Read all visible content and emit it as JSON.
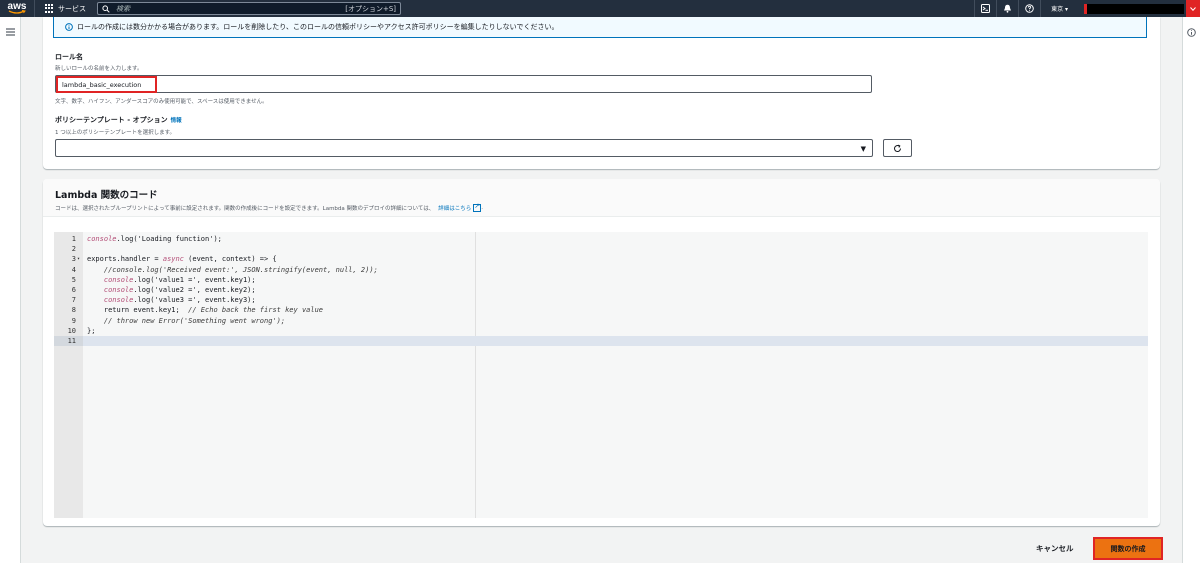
{
  "nav": {
    "logo": "aws",
    "services_label": "サービス",
    "search_placeholder": "検索",
    "search_shortcut": "[オプション+S]",
    "region": "東京 ▾"
  },
  "info_alert": {
    "text": "ロールの作成には数分かかる場合があります。ロールを削除したり、このロールの信頼ポリシーやアクセス許可ポリシーを編集したりしないでください。"
  },
  "role_name": {
    "label": "ロール名",
    "description": "新しいロールの名前を入力します。",
    "value": "lambda_basic_execution",
    "constraint": "文字、数字、ハイフン、アンダースコアのみ使用可能で、スペースは使用できません。"
  },
  "policy_templates": {
    "label": "ポリシーテンプレート - オプション",
    "info_link": "情報",
    "description": "1 つ以上のポリシーテンプレートを選択します。",
    "selected": ""
  },
  "code_section": {
    "title": "Lambda 関数のコード",
    "description": "コードは、選択されたブループリントによって事前に設定されます。関数の作成後にコードを設定できます。Lambda 関数のデプロイの詳細については、",
    "link": "詳細はこちら"
  },
  "code_lines": [
    {
      "n": "1",
      "fold": "",
      "segments": [
        [
          "fn",
          "console"
        ],
        [
          "",
          ".log('Loading function');"
        ]
      ]
    },
    {
      "n": "2",
      "fold": "",
      "segments": []
    },
    {
      "n": "3",
      "fold": "▾",
      "segments": [
        [
          "",
          "exports.handler = "
        ],
        [
          "fn",
          "async"
        ],
        [
          "",
          " (event, context) => {"
        ]
      ]
    },
    {
      "n": "4",
      "fold": "",
      "segments": [
        [
          "cm",
          "    //console.log('Received event:', JSON.stringify(event, null, 2));"
        ]
      ]
    },
    {
      "n": "5",
      "fold": "",
      "segments": [
        [
          "",
          "    "
        ],
        [
          "fn",
          "console"
        ],
        [
          "",
          ".log('value1 =', event.key1);"
        ]
      ]
    },
    {
      "n": "6",
      "fold": "",
      "segments": [
        [
          "",
          "    "
        ],
        [
          "fn",
          "console"
        ],
        [
          "",
          ".log('value2 =', event.key2);"
        ]
      ]
    },
    {
      "n": "7",
      "fold": "",
      "segments": [
        [
          "",
          "    "
        ],
        [
          "fn",
          "console"
        ],
        [
          "",
          ".log('value3 =', event.key3);"
        ]
      ]
    },
    {
      "n": "8",
      "fold": "",
      "segments": [
        [
          "",
          "    return event.key1;  "
        ],
        [
          "cm",
          "// Echo back the first key value"
        ]
      ]
    },
    {
      "n": "9",
      "fold": "",
      "segments": [
        [
          "cm",
          "    // throw new Error('Something went wrong');"
        ]
      ]
    },
    {
      "n": "10",
      "fold": "",
      "segments": [
        [
          "",
          "};"
        ]
      ]
    },
    {
      "n": "11",
      "fold": "",
      "segments": [],
      "active": true
    }
  ],
  "footer": {
    "cancel_label": "キャンセル",
    "create_label": "関数の作成"
  },
  "colors": {
    "nav_bg": "#232f3e",
    "primary_button": "#ec7211",
    "highlight_border": "#e02424",
    "link": "#0073bb"
  }
}
